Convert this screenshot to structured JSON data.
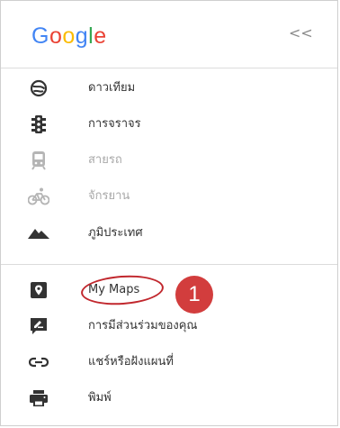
{
  "header": {
    "logo_letters": [
      {
        "char": "G",
        "color": "#4285F4"
      },
      {
        "char": "o",
        "color": "#EA4335"
      },
      {
        "char": "o",
        "color": "#FBBC05"
      },
      {
        "char": "g",
        "color": "#4285F4"
      },
      {
        "char": "l",
        "color": "#34A853"
      },
      {
        "char": "e",
        "color": "#EA4335"
      }
    ],
    "collapse_label": "<<"
  },
  "menu": {
    "layers": [
      {
        "label": "ดาวเทียม",
        "icon": "satellite-icon",
        "disabled": false
      },
      {
        "label": "การจราจร",
        "icon": "traffic-light-icon",
        "disabled": false
      },
      {
        "label": "สายรถ",
        "icon": "transit-icon",
        "disabled": true
      },
      {
        "label": "จักรยาน",
        "icon": "bicycle-icon",
        "disabled": true
      },
      {
        "label": "ภูมิประเทศ",
        "icon": "terrain-icon",
        "disabled": false
      }
    ],
    "actions": [
      {
        "label": "My Maps",
        "icon": "map-pin-icon"
      },
      {
        "label": "การมีส่วนร่วมของคุณ",
        "icon": "edit-icon"
      },
      {
        "label": "แชร์หรือฝังแผนที่",
        "icon": "link-icon"
      },
      {
        "label": "พิมพ์",
        "icon": "printer-icon"
      }
    ]
  },
  "annotation": {
    "step_number": "1",
    "color": "#D23D3D"
  }
}
